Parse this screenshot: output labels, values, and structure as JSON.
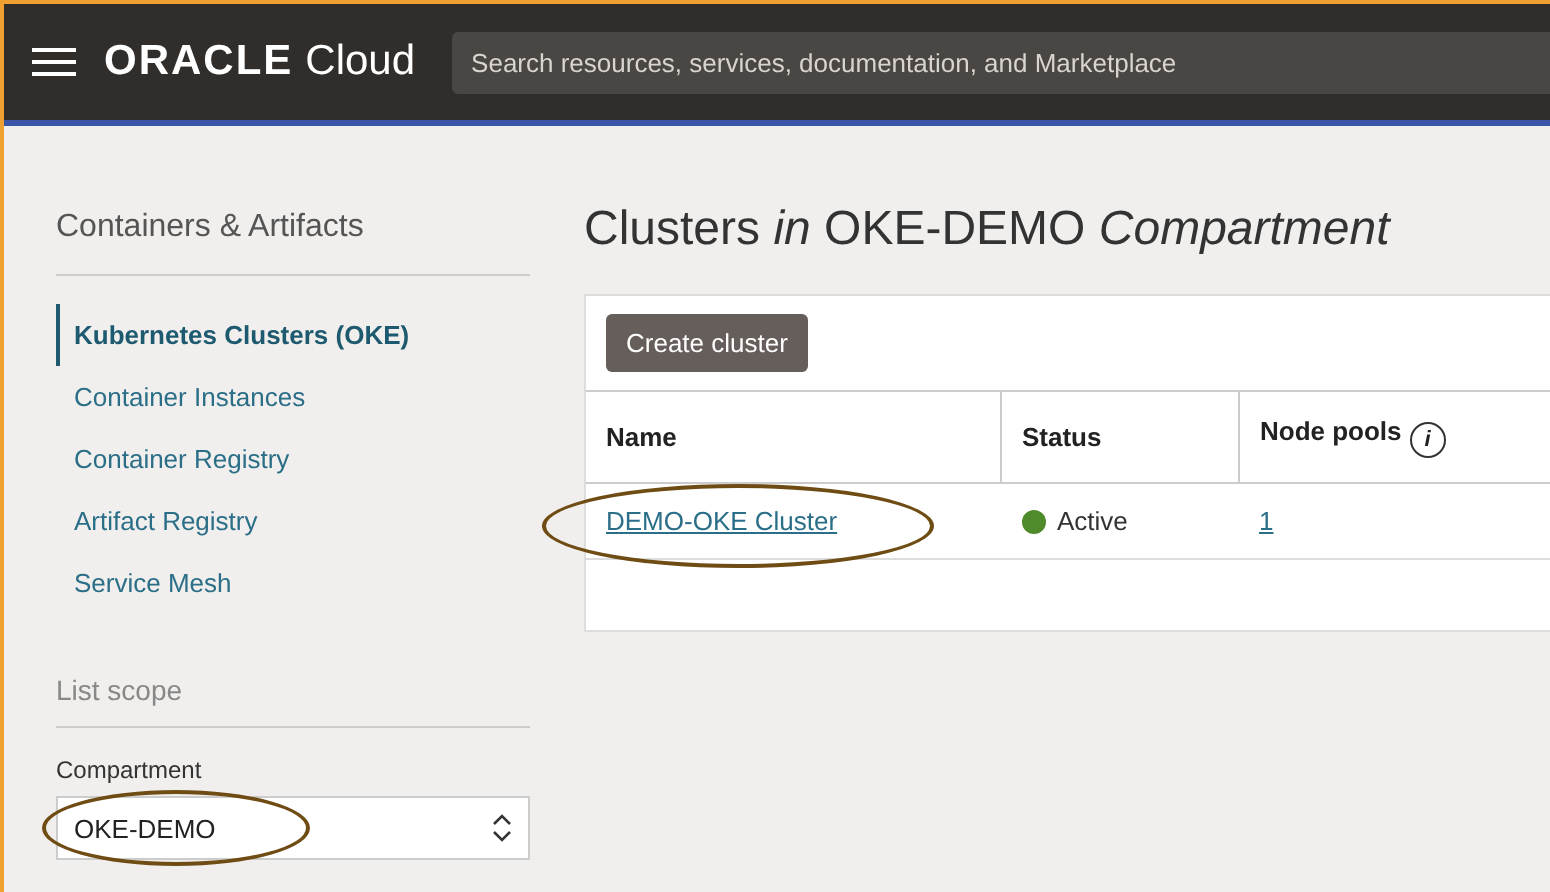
{
  "header": {
    "logo": "ORACLE",
    "product": "Cloud",
    "search": {
      "placeholder": "Search resources, services, documentation, and Marketplace"
    }
  },
  "sidebar": {
    "title": "Containers & Artifacts",
    "items": [
      {
        "label": "Kubernetes Clusters (OKE)",
        "selected": true
      },
      {
        "label": "Container Instances",
        "selected": false
      },
      {
        "label": "Container Registry",
        "selected": false
      },
      {
        "label": "Artifact Registry",
        "selected": false
      },
      {
        "label": "Service Mesh",
        "selected": false
      }
    ],
    "scope": {
      "title": "List scope",
      "compartment_label": "Compartment",
      "compartment_value": "OKE-DEMO",
      "circled": true
    }
  },
  "main": {
    "title": "Clusters *in* OKE-DEMO *Compartment*",
    "create_button": "Create cluster",
    "table": {
      "columns": [
        "Name",
        "Status",
        "Node pools"
      ],
      "info_icon": "i",
      "rows": [
        {
          "name": "DEMO-OKE Cluster",
          "circled": true,
          "status": "Active",
          "color": "#4f8a2b",
          "node_pools": "1"
        }
      ]
    }
  }
}
